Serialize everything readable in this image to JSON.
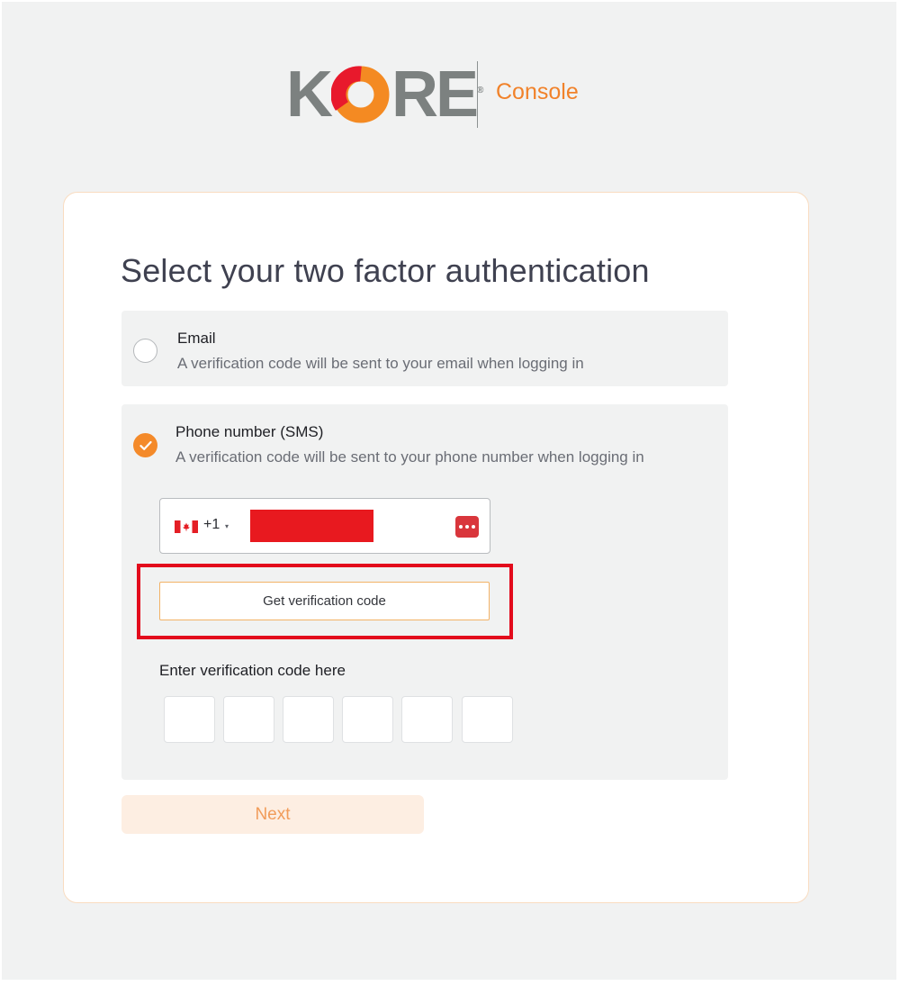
{
  "brand": {
    "logo_text_left": "K",
    "logo_text_right": "RE",
    "logo_registered": "®",
    "product_name": "Console",
    "colors": {
      "orange": "#f1822a",
      "grey": "#7c8180",
      "red": "#e30b1c"
    }
  },
  "page": {
    "title": "Select your two factor authentication"
  },
  "options": {
    "email": {
      "title": "Email",
      "description": "A verification code will be sent to your email when logging in",
      "selected": false
    },
    "sms": {
      "title": "Phone number (SMS)",
      "description": "A verification code will be sent to your phone number when logging in",
      "selected": true
    }
  },
  "phone": {
    "country_flag": "canada-flag-icon",
    "dial_code": "+1",
    "caret": "▾",
    "number_redacted": true,
    "password_manager_icon": "password-dots-icon"
  },
  "verify_button": {
    "label": "Get verification code"
  },
  "code_entry": {
    "label": "Enter verification code here",
    "digits": [
      "",
      "",
      "",
      "",
      "",
      ""
    ]
  },
  "next_button": {
    "label": "Next"
  }
}
